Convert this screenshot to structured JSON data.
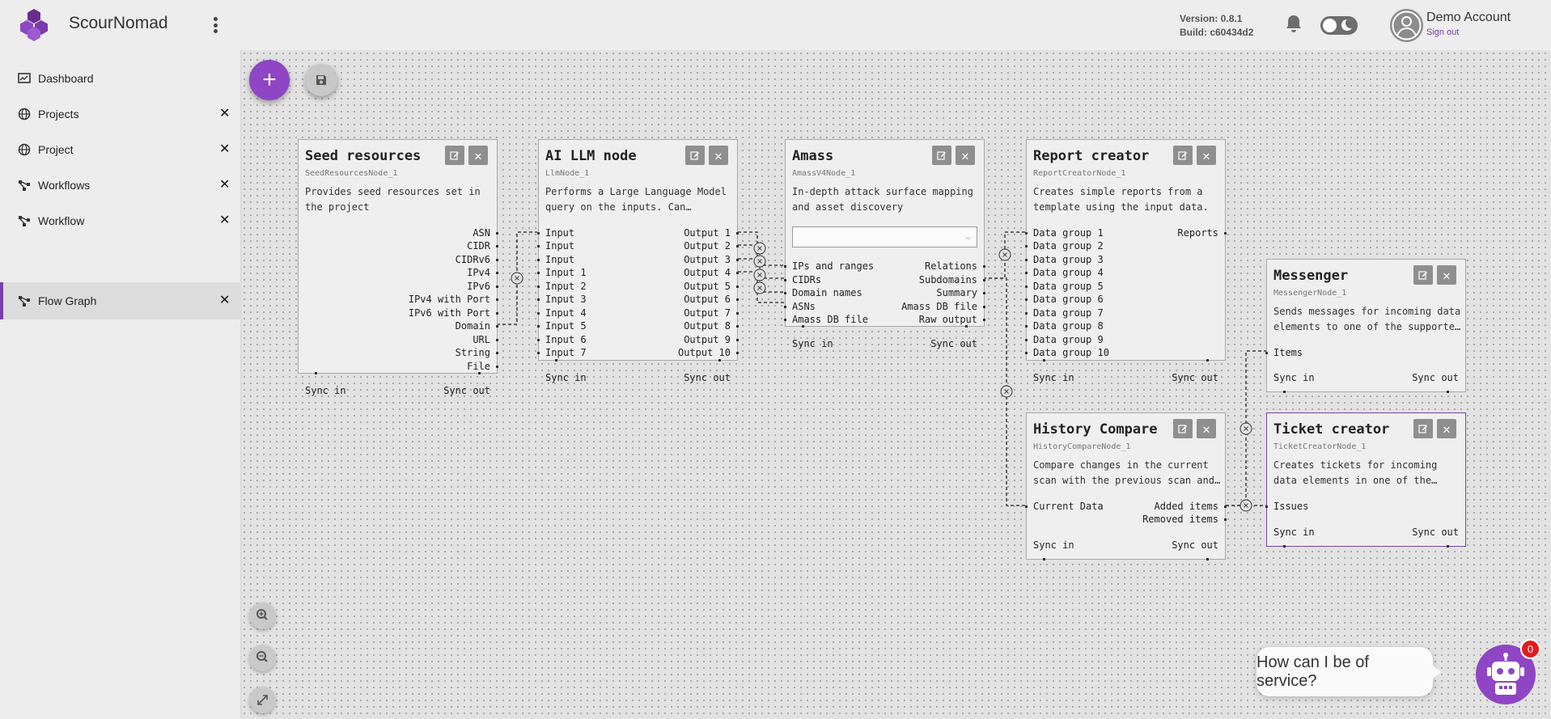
{
  "app": {
    "name": "ScourNomad",
    "version": "Version: 0.8.1",
    "build": "Build: c60434d2"
  },
  "account": {
    "name": "Demo Account",
    "signout": "Sign out"
  },
  "sidebar": {
    "items": [
      {
        "label": "Dashboard",
        "icon": "dashboard-icon",
        "closable": false
      },
      {
        "label": "Projects",
        "icon": "globe-icon",
        "closable": true
      },
      {
        "label": "Project",
        "icon": "globe-icon",
        "closable": true
      },
      {
        "label": "Workflows",
        "icon": "workflow-icon",
        "closable": true
      },
      {
        "label": "Workflow",
        "icon": "workflow-icon",
        "closable": true
      },
      {
        "label": "Flow Graph",
        "icon": "workflow-icon",
        "closable": true,
        "active": true
      }
    ]
  },
  "nodes": {
    "seed": {
      "title": "Seed resources",
      "id": "SeedResourcesNode_1",
      "desc": "Provides seed resources set in the project",
      "outputs": [
        "ASN",
        "CIDR",
        "CIDRv6",
        "IPv4",
        "IPv6",
        "IPv4 with Port",
        "IPv6 with Port",
        "Domain",
        "URL",
        "String",
        "File"
      ],
      "sync_in": "Sync in",
      "sync_out": "Sync out"
    },
    "llm": {
      "title": "AI LLM node",
      "id": "LlmNode_1",
      "desc": "Performs a Large Language Model query on the inputs. Can…",
      "inputs": [
        "Input",
        "Input",
        "Input",
        "Input 1",
        "Input 2",
        "Input 3",
        "Input 4",
        "Input 5",
        "Input 6",
        "Input 7"
      ],
      "outputs": [
        "Output 1",
        "Output 2",
        "Output 3",
        "Output 4",
        "Output 5",
        "Output 6",
        "Output 7",
        "Output 8",
        "Output 9",
        "Output 10"
      ],
      "sync_in": "Sync in",
      "sync_out": "Sync out"
    },
    "amass": {
      "title": "Amass",
      "id": "AmassV4Node_1",
      "desc": "In-depth attack surface mapping and asset discovery",
      "select_value": "",
      "inputs": [
        "IPs and ranges",
        "CIDRs",
        "Domain names",
        "ASNs",
        "Amass DB file"
      ],
      "outputs": [
        "Relations",
        "Subdomains",
        "Summary",
        "Amass DB file",
        "Raw output"
      ],
      "sync_in": "Sync in",
      "sync_out": "Sync out"
    },
    "report": {
      "title": "Report creator",
      "id": "ReportCreatorNode_1",
      "desc": "Creates simple reports from a template using the input data.",
      "inputs": [
        "Data group 1",
        "Data group 2",
        "Data group 3",
        "Data group 4",
        "Data group 5",
        "Data group 6",
        "Data group 7",
        "Data group 8",
        "Data group 9",
        "Data group 10"
      ],
      "outputs": [
        "Reports"
      ],
      "sync_in": "Sync in",
      "sync_out": "Sync out"
    },
    "messenger": {
      "title": "Messenger",
      "id": "MessengerNode_1",
      "desc": "Sends messages for incoming data elements to one of the supporte…",
      "inputs": [
        "Items"
      ],
      "sync_in": "Sync in",
      "sync_out": "Sync out"
    },
    "history": {
      "title": "History Compare",
      "id": "HistoryCompareNode_1",
      "desc": "Compare changes in the current scan with the previous scan and…",
      "inputs": [
        "Current Data"
      ],
      "outputs": [
        "Added items",
        "Removed items"
      ],
      "sync_in": "Sync in",
      "sync_out": "Sync out"
    },
    "ticket": {
      "title": "Ticket creator",
      "id": "TicketCreatorNode_1",
      "desc": "Creates tickets for incoming data elements in one of the…",
      "inputs": [
        "Issues"
      ],
      "sync_in": "Sync in",
      "sync_out": "Sync out"
    }
  },
  "chat": {
    "prompt": "How can I be of service?",
    "badge": "0"
  },
  "colors": {
    "accent": "#8e46c4",
    "badge": "#e31b1b"
  }
}
